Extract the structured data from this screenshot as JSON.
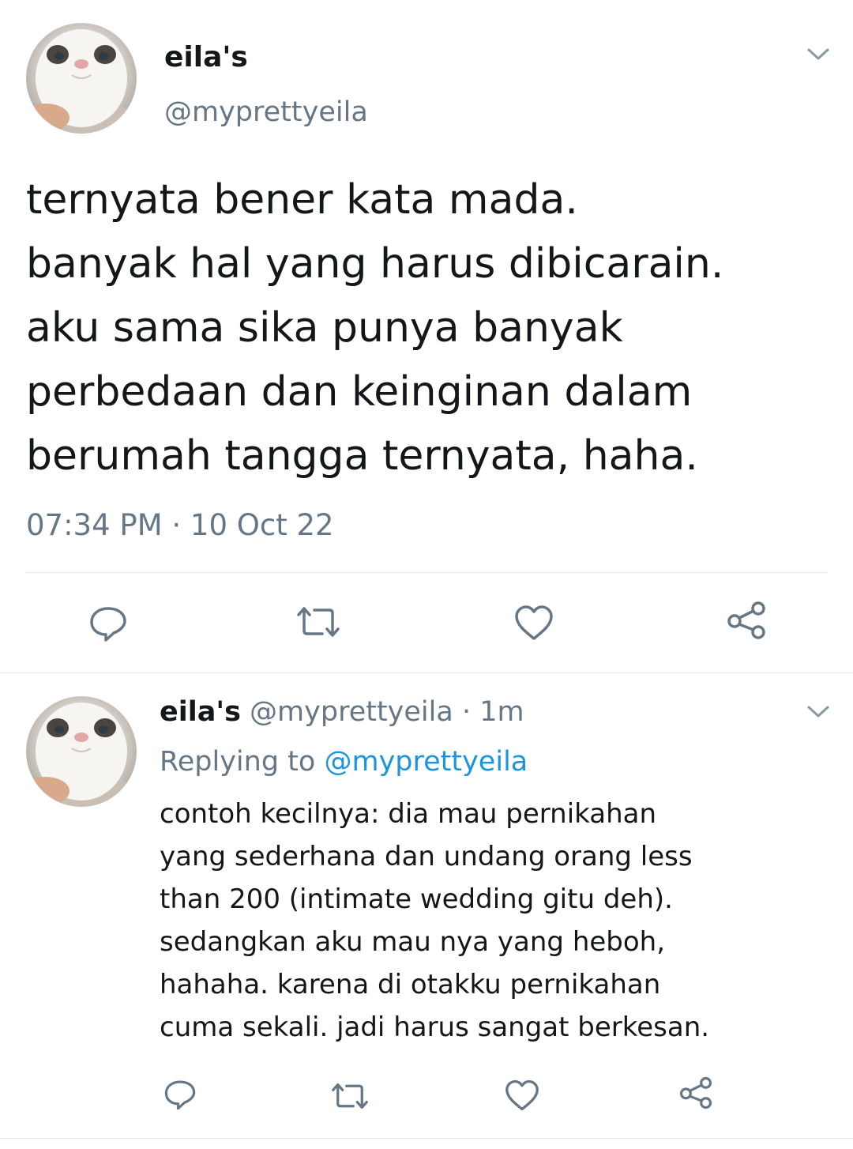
{
  "main_tweet": {
    "display_name": "eila's",
    "handle": "@myprettyeila",
    "text_lines": [
      "ternyata bener kata mada.",
      "banyak hal yang harus dibicarain.",
      "aku sama sika punya banyak",
      "perbedaan dan keinginan dalam",
      "berumah tangga ternyata, haha."
    ],
    "timestamp": "07:34 PM · 10 Oct 22",
    "actions": [
      "reply-icon",
      "retweet-icon",
      "like-icon",
      "share-icon"
    ]
  },
  "reply_tweet": {
    "display_name": "eila's",
    "handle": "@myprettyeila",
    "separator": "·",
    "time_ago": "1m",
    "replying_label": "Replying to",
    "replying_handle": "@myprettyeila",
    "text_lines": [
      "contoh kecilnya: dia mau pernikahan",
      "yang sederhana dan undang orang less",
      "than 200 (intimate wedding gitu deh).",
      "sedangkan aku mau nya yang heboh,",
      "hahaha. karena di otakku pernikahan",
      "cuma sekali. jadi harus sangat berkesan."
    ],
    "actions": [
      "reply-icon",
      "retweet-icon",
      "like-icon",
      "share-icon"
    ]
  },
  "colors": {
    "text": "#14171a",
    "muted": "#657786",
    "link": "#1b95e0",
    "divider": "#e1e8ed",
    "icon": "#657786"
  }
}
